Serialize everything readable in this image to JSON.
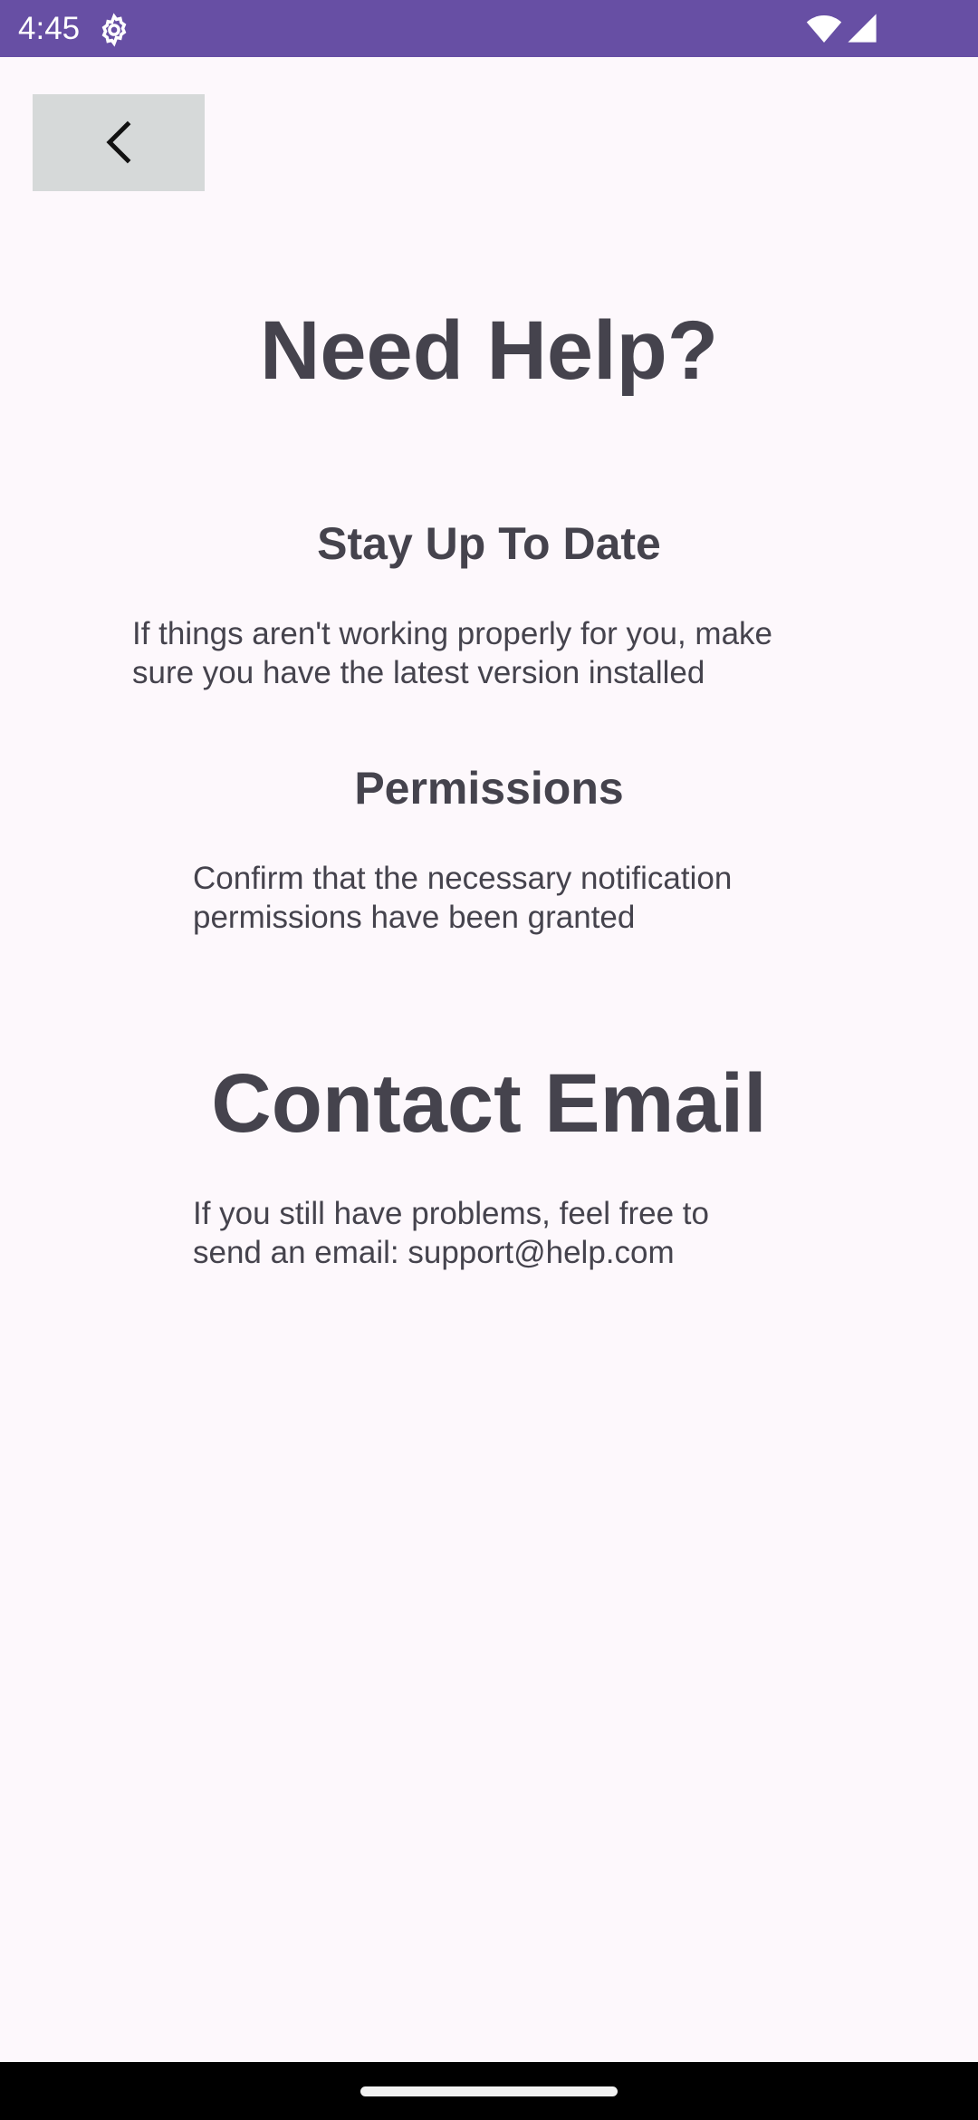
{
  "status_bar": {
    "time": "4:45",
    "icons": [
      "settings-gear-icon",
      "wifi-icon",
      "cellular-signal-icon"
    ],
    "background_color": "#674fa4"
  },
  "toolbar": {
    "back_icon": "chevron-left-icon"
  },
  "help": {
    "title": "Need Help?",
    "sections": [
      {
        "heading": "Stay Up To Date",
        "body_line1": "If things aren't working properly for you, make",
        "body_line2": "sure you have the latest version installed"
      },
      {
        "heading": "Permissions",
        "body_line1": "Confirm that the necessary notification",
        "body_line2": "permissions have been granted"
      }
    ]
  },
  "contact": {
    "title": "Contact Email",
    "body_line1": "If you still have problems, feel free to",
    "body_line2": "send an email: support@help.com"
  },
  "colors": {
    "text": "#45434d",
    "background": "#fdf8fc",
    "back_button": "#d6d9d9"
  }
}
